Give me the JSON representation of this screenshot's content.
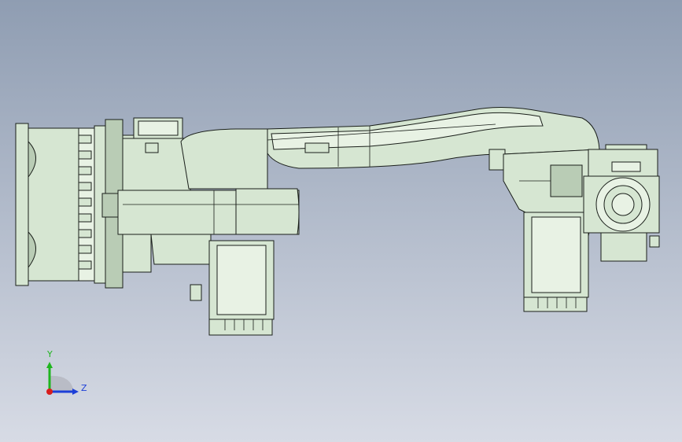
{
  "viewport": {
    "background_top": "#8f9db2",
    "background_bottom": "#d7dbe5",
    "model_color": "#d6e6d2"
  },
  "triad": {
    "y_label": "Y",
    "z_label": "Z",
    "y_color": "#1fb51f",
    "z_color": "#1d3fd8",
    "x_color": "#d81d1d"
  }
}
